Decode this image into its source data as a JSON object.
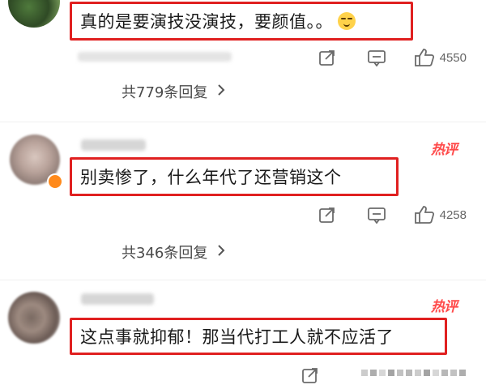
{
  "comments": [
    {
      "text": "真的是要演技没演技，要颜值。。",
      "has_emoji": true,
      "hot_badge": "",
      "like_count": "4550",
      "reply_link": "共779条回复"
    },
    {
      "text": "别卖惨了，什么年代了还营销这个",
      "has_emoji": false,
      "hot_badge": "热评",
      "like_count": "4258",
      "reply_link": "共346条回复"
    },
    {
      "text": "这点事就抑郁！那当代打工人就不应活了",
      "has_emoji": false,
      "hot_badge": "热评",
      "like_count": "",
      "reply_link": ""
    }
  ],
  "icons": {
    "share": "share-icon",
    "reply": "comment-icon",
    "like": "thumbs-up-icon",
    "chevron": "chevron-right-icon"
  },
  "colors": {
    "highlight_box": "#e02020",
    "hot_badge": "#ff4a4a",
    "icon_gray": "#6b6b6b"
  }
}
